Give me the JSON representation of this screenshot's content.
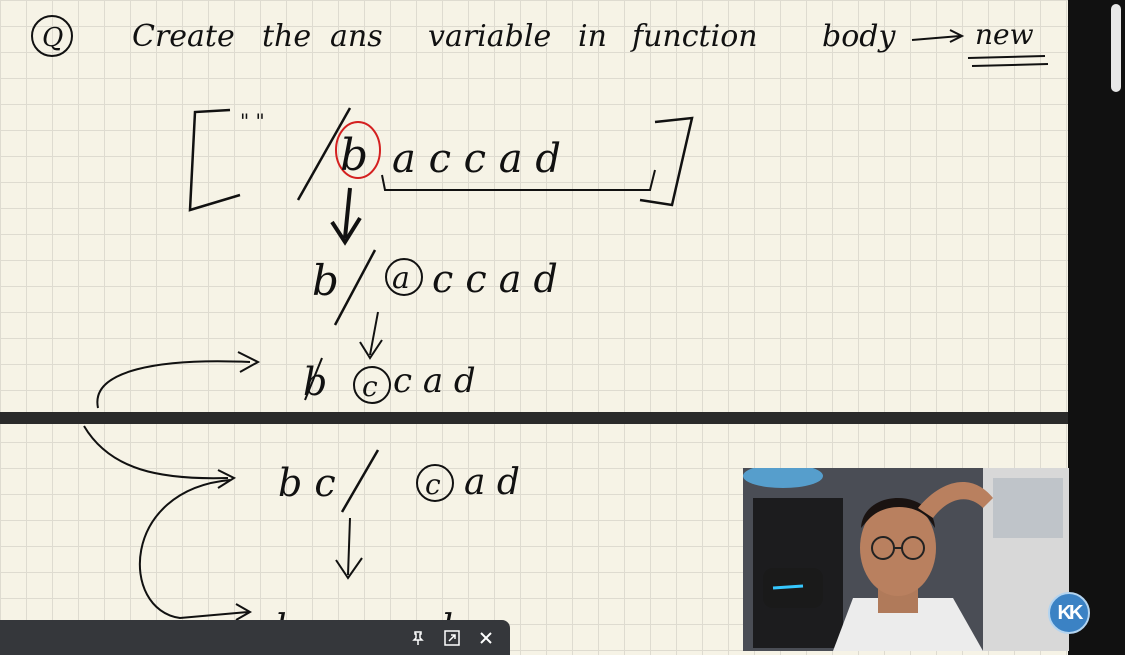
{
  "notes": {
    "heading_marker": "Q",
    "heading_words": [
      "Create",
      "the",
      "ans",
      "variable",
      "in",
      "function",
      "body",
      "new"
    ],
    "row1": {
      "quotes": "\"  \"",
      "first": "b",
      "rest": "a c c a d"
    },
    "row2": {
      "left": "b",
      "circled": "a",
      "rest": "c c a d"
    },
    "row3": {
      "left": "b",
      "circled": "c",
      "rest": "c a d"
    },
    "row4": {
      "left": "b c",
      "circled": "c",
      "rest": "a d"
    },
    "row5": {
      "left": "b c c",
      "rest": "d"
    }
  },
  "overlay": {
    "logo_text": "KK",
    "pin_icon": "pin-icon",
    "expand_icon": "expand-icon",
    "close_icon": "close-icon"
  }
}
